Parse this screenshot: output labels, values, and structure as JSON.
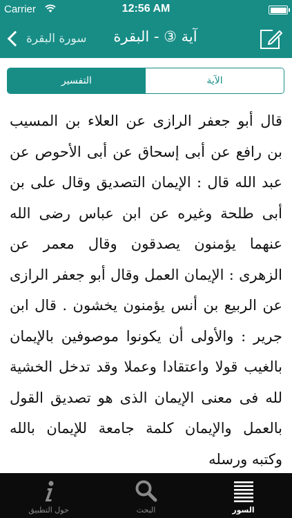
{
  "status_bar": {
    "carrier": "Carrier",
    "time": "12:56 AM"
  },
  "nav": {
    "back_label": "سورة البقرة",
    "title": "آية ③ - البقرة"
  },
  "segments": [
    {
      "label": "التفسير",
      "selected": true
    },
    {
      "label": "الآية",
      "selected": false
    }
  ],
  "content": {
    "text": "قال أبو جعفر الرازى عن العلاء بن المسيب بن رافع عن أبى إسحاق عن أبى الأحوص عن عبد الله قال : الإيمان التصديق وقال على بن أبى طلحة وغيره عن ابن عباس رضى الله عنهما يؤمنون يصدقون وقال معمر عن الزهرى : الإيمان العمل وقال أبو جعفر الرازى عن الربيع بن أنس يؤمنون يخشون . قال ابن جرير : والأولى أن يكونوا موصوفين بالإيمان بالغيب قولا واعتقادا وعملا وقد تدخل الخشية لله فى معنى الإيمان الذى هو تصديق القول بالعمل والإيمان كلمة جامعة للإيمان بالله وكتبه ورسله"
  },
  "tabbar": {
    "items": [
      {
        "label": "حول التطبيق",
        "icon": "info-icon",
        "active": false
      },
      {
        "label": "البحث",
        "icon": "search-icon",
        "active": false
      },
      {
        "label": "السور",
        "icon": "list-icon",
        "active": true
      }
    ]
  },
  "colors": {
    "brand": "#178d86",
    "tabbar": "#0c0c0c"
  }
}
